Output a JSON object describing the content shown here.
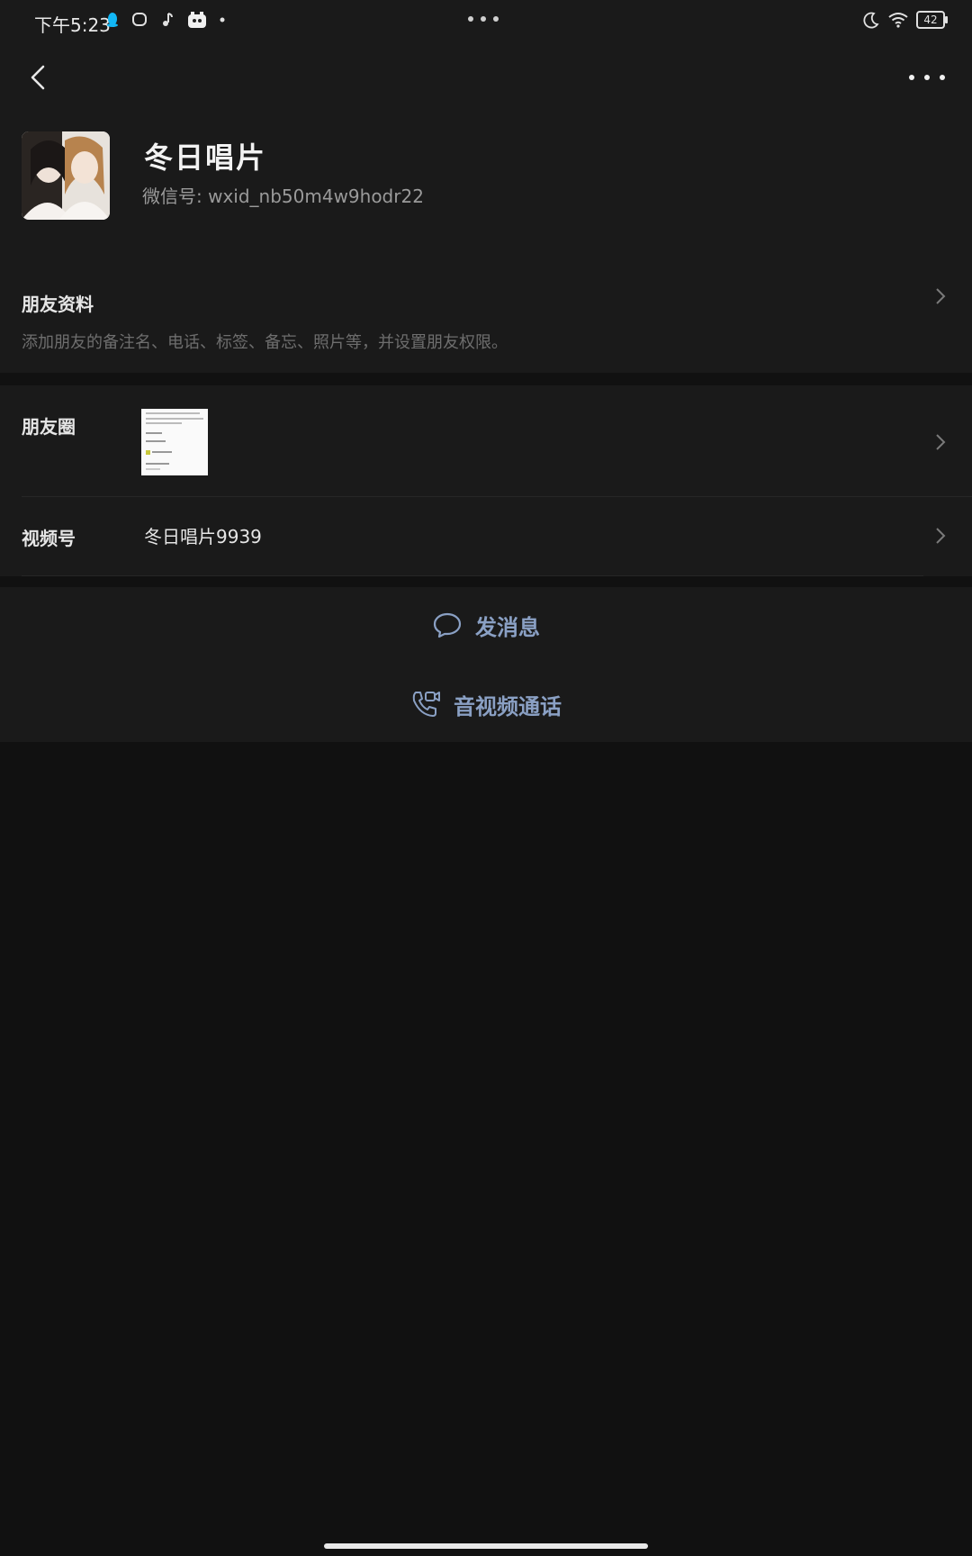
{
  "status_bar": {
    "time": "下午5:23",
    "battery": "42",
    "left_icons": [
      "qq-icon",
      "message-icon",
      "music-icon",
      "app-icon",
      "dot-icon"
    ],
    "right_icons": [
      "moon-icon",
      "wifi-icon",
      "battery-icon"
    ]
  },
  "profile": {
    "name": "冬日唱片",
    "wechat_id": "微信号: wxid_nb50m4w9hodr22"
  },
  "friend_info": {
    "title": "朋友资料",
    "description": "添加朋友的备注名、电话、标签、备忘、照片等，并设置朋友权限。"
  },
  "moments": {
    "label": "朋友圈"
  },
  "channels": {
    "label": "视频号",
    "value": "冬日唱片9939"
  },
  "actions": {
    "message": "发消息",
    "call": "音视频通话"
  },
  "colors": {
    "background": "#111111",
    "section_bg": "#1a1a1a",
    "action_text": "#8aa0c4"
  }
}
